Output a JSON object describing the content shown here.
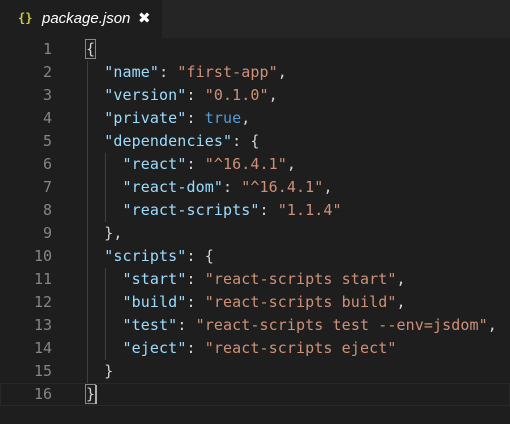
{
  "tab": {
    "icon": "{}",
    "filename": "package.json",
    "close_glyph": "✖",
    "icon_color": "#cbcb41"
  },
  "colors": {
    "background": "#1e1e1e",
    "key": "#9cdcfe",
    "string": "#ce9178",
    "boolean": "#569cd6",
    "punctuation": "#d4d4d4",
    "line_number": "#858585"
  },
  "lines": [
    {
      "n": "1",
      "tokens": [
        {
          "t": "p",
          "v": "{"
        }
      ]
    },
    {
      "n": "2",
      "tokens": [
        {
          "t": "p",
          "v": "  "
        },
        {
          "t": "k",
          "v": "\"name\""
        },
        {
          "t": "p",
          "v": ": "
        },
        {
          "t": "s",
          "v": "\"first-app\""
        },
        {
          "t": "p",
          "v": ","
        }
      ]
    },
    {
      "n": "3",
      "tokens": [
        {
          "t": "p",
          "v": "  "
        },
        {
          "t": "k",
          "v": "\"version\""
        },
        {
          "t": "p",
          "v": ": "
        },
        {
          "t": "s",
          "v": "\"0.1.0\""
        },
        {
          "t": "p",
          "v": ","
        }
      ]
    },
    {
      "n": "4",
      "tokens": [
        {
          "t": "p",
          "v": "  "
        },
        {
          "t": "k",
          "v": "\"private\""
        },
        {
          "t": "p",
          "v": ": "
        },
        {
          "t": "b",
          "v": "true"
        },
        {
          "t": "p",
          "v": ","
        }
      ]
    },
    {
      "n": "5",
      "tokens": [
        {
          "t": "p",
          "v": "  "
        },
        {
          "t": "k",
          "v": "\"dependencies\""
        },
        {
          "t": "p",
          "v": ": {"
        }
      ]
    },
    {
      "n": "6",
      "tokens": [
        {
          "t": "p",
          "v": "    "
        },
        {
          "t": "k",
          "v": "\"react\""
        },
        {
          "t": "p",
          "v": ": "
        },
        {
          "t": "s",
          "v": "\"^16.4.1\""
        },
        {
          "t": "p",
          "v": ","
        }
      ]
    },
    {
      "n": "7",
      "tokens": [
        {
          "t": "p",
          "v": "    "
        },
        {
          "t": "k",
          "v": "\"react-dom\""
        },
        {
          "t": "p",
          "v": ": "
        },
        {
          "t": "s",
          "v": "\"^16.4.1\""
        },
        {
          "t": "p",
          "v": ","
        }
      ]
    },
    {
      "n": "8",
      "tokens": [
        {
          "t": "p",
          "v": "    "
        },
        {
          "t": "k",
          "v": "\"react-scripts\""
        },
        {
          "t": "p",
          "v": ": "
        },
        {
          "t": "s",
          "v": "\"1.1.4\""
        }
      ]
    },
    {
      "n": "9",
      "tokens": [
        {
          "t": "p",
          "v": "  },"
        }
      ]
    },
    {
      "n": "10",
      "tokens": [
        {
          "t": "p",
          "v": "  "
        },
        {
          "t": "k",
          "v": "\"scripts\""
        },
        {
          "t": "p",
          "v": ": {"
        }
      ]
    },
    {
      "n": "11",
      "tokens": [
        {
          "t": "p",
          "v": "    "
        },
        {
          "t": "k",
          "v": "\"start\""
        },
        {
          "t": "p",
          "v": ": "
        },
        {
          "t": "s",
          "v": "\"react-scripts start\""
        },
        {
          "t": "p",
          "v": ","
        }
      ]
    },
    {
      "n": "12",
      "tokens": [
        {
          "t": "p",
          "v": "    "
        },
        {
          "t": "k",
          "v": "\"build\""
        },
        {
          "t": "p",
          "v": ": "
        },
        {
          "t": "s",
          "v": "\"react-scripts build\""
        },
        {
          "t": "p",
          "v": ","
        }
      ]
    },
    {
      "n": "13",
      "tokens": [
        {
          "t": "p",
          "v": "    "
        },
        {
          "t": "k",
          "v": "\"test\""
        },
        {
          "t": "p",
          "v": ": "
        },
        {
          "t": "s",
          "v": "\"react-scripts test --env=jsdom\""
        },
        {
          "t": "p",
          "v": ","
        }
      ]
    },
    {
      "n": "14",
      "tokens": [
        {
          "t": "p",
          "v": "    "
        },
        {
          "t": "k",
          "v": "\"eject\""
        },
        {
          "t": "p",
          "v": ": "
        },
        {
          "t": "s",
          "v": "\"react-scripts eject\""
        }
      ]
    },
    {
      "n": "15",
      "tokens": [
        {
          "t": "p",
          "v": "  }"
        }
      ]
    },
    {
      "n": "16",
      "tokens": [
        {
          "t": "p",
          "v": "}"
        }
      ]
    }
  ]
}
